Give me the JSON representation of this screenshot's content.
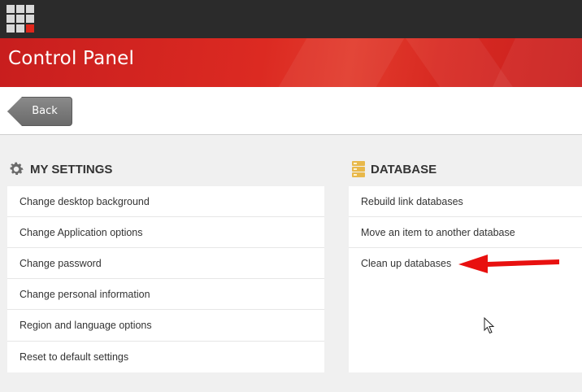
{
  "header": {
    "app_icon": "app-grid-icon",
    "title": "Control Panel"
  },
  "toolbar": {
    "back_label": "Back"
  },
  "sections": {
    "my_settings": {
      "title": "MY SETTINGS",
      "icon": "gear-icon",
      "items": [
        "Change desktop background",
        "Change Application options",
        "Change password",
        "Change personal information",
        "Region and language options",
        "Reset to default settings"
      ]
    },
    "database": {
      "title": "DATABASE",
      "icon": "database-icon",
      "items": [
        "Rebuild link databases",
        "Move an item to another database",
        "Clean up databases"
      ]
    }
  },
  "colors": {
    "topbar": "#2b2b2b",
    "banner": "#d82a22",
    "accent": "#e0261b",
    "annotation_arrow": "#e8100f"
  }
}
